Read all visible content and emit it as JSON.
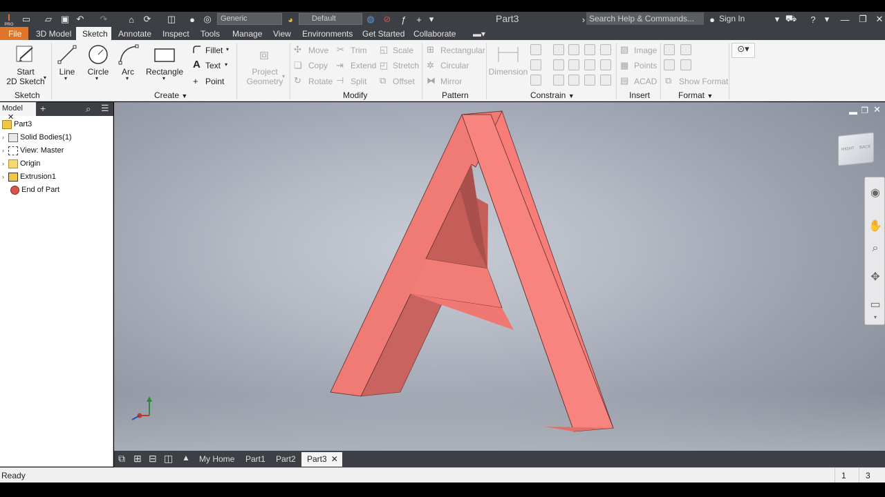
{
  "app": {
    "document_title": "Part3",
    "search_placeholder": "Search Help & Commands...",
    "sign_in": "Sign In",
    "material_dropdown": "Generic",
    "appearance_dropdown": "Default",
    "pro_badge": "PRO"
  },
  "menu": {
    "tabs": [
      "File",
      "3D Model",
      "Sketch",
      "Annotate",
      "Inspect",
      "Tools",
      "Manage",
      "View",
      "Environments",
      "Get Started",
      "Collaborate"
    ],
    "active_tab": "Sketch"
  },
  "ribbon": {
    "sketch_panel": {
      "label": "Sketch",
      "start_line1": "Start",
      "start_line2": "2D Sketch"
    },
    "create_panel": {
      "label": "Create",
      "line": "Line",
      "circle": "Circle",
      "arc": "Arc",
      "rectangle": "Rectangle",
      "fillet": "Fillet",
      "text": "Text",
      "point": "Point",
      "project_geometry_line1": "Project",
      "project_geometry_line2": "Geometry"
    },
    "modify_panel": {
      "label": "Modify",
      "move": "Move",
      "trim": "Trim",
      "scale": "Scale",
      "copy": "Copy",
      "extend": "Extend",
      "stretch": "Stretch",
      "rotate": "Rotate",
      "split": "Split",
      "offset": "Offset"
    },
    "pattern_panel": {
      "label": "Pattern",
      "rectangular": "Rectangular",
      "circular": "Circular",
      "mirror": "Mirror"
    },
    "constrain_panel": {
      "label": "Constrain",
      "dimension": "Dimension"
    },
    "insert_panel": {
      "label": "Insert",
      "image": "Image",
      "points": "Points",
      "acad": "ACAD"
    },
    "format_panel": {
      "label": "Format",
      "show_format": "Show Format"
    }
  },
  "browser": {
    "tab_label": "Model",
    "items": [
      {
        "label": "Part3",
        "icon": "part-icon"
      },
      {
        "label": "Solid Bodies(1)",
        "icon": "solid-bodies-icon"
      },
      {
        "label": "View: Master",
        "icon": "view-icon"
      },
      {
        "label": "Origin",
        "icon": "folder-icon"
      },
      {
        "label": "Extrusion1",
        "icon": "extrusion-icon"
      },
      {
        "label": "End of Part",
        "icon": "end-of-part-icon"
      }
    ]
  },
  "viewcube": {
    "face_right": "RIGHT",
    "face_back": "BACK"
  },
  "doc_tabs": [
    "My Home",
    "Part1",
    "Part2",
    "Part3"
  ],
  "status": {
    "text": "Ready",
    "count1": "1",
    "count2": "3"
  },
  "colors": {
    "accent": "#e0762b",
    "model_fill": "#f07e78",
    "dark_chrome": "#3c3f44"
  }
}
